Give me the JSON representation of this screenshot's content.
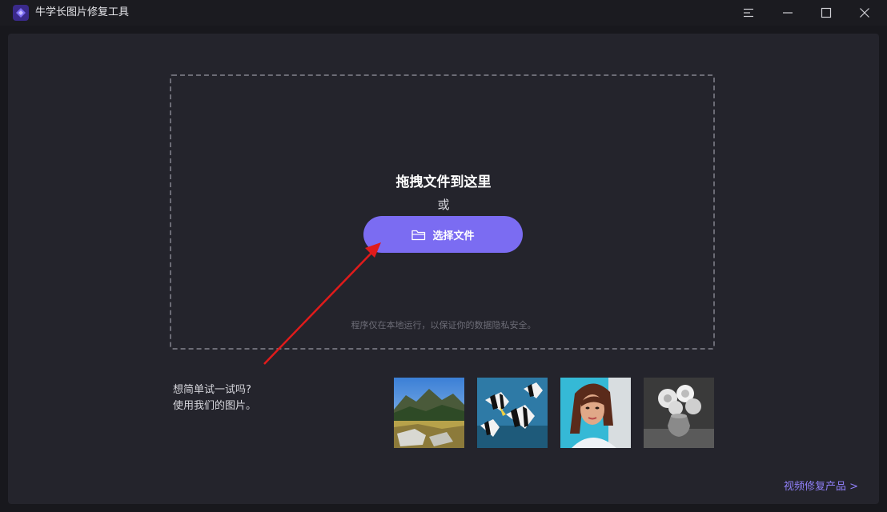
{
  "window": {
    "title": "牛学长图片修复工具",
    "controls": [
      "menu-icon",
      "minimize-icon",
      "maximize-icon",
      "close-icon"
    ]
  },
  "dropzone": {
    "title": "拖拽文件到这里",
    "or_text": "或",
    "select_button_label": "选择文件",
    "select_button_icon": "folder-icon",
    "privacy_note": "程序仅在本地运行，以保证你的数据隐私安全。"
  },
  "samples": {
    "prompt_line1": "想简单试一试吗?",
    "prompt_line2": "使用我们的图片。",
    "images": [
      "landscape-photo",
      "zebra-fish-photo",
      "portrait-photo",
      "flower-vase-photo"
    ]
  },
  "footer": {
    "video_link": "视频修复产品 >"
  },
  "colors": {
    "accent": "#7b6cf2",
    "link": "#8f7ff7",
    "annotation_arrow": "#e01b1b"
  }
}
